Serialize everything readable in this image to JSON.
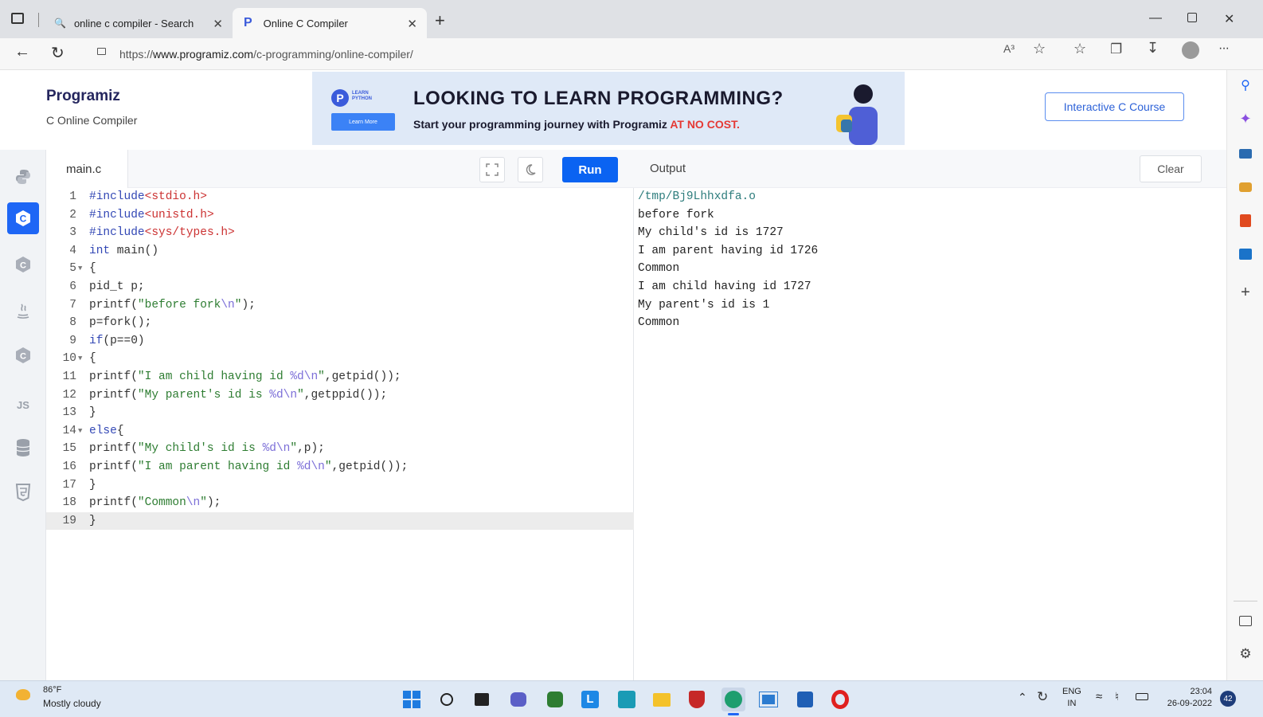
{
  "browser": {
    "tabs": [
      {
        "title": "online c compiler - Search",
        "active": false
      },
      {
        "title": "Online C Compiler",
        "active": true
      }
    ],
    "new_tab_label": "+",
    "url_scheme": "https://",
    "url_host": "www.programiz.com",
    "url_path": "/c-programming/online-compiler/",
    "read_aloud_label": "A³",
    "more_label": "···"
  },
  "site": {
    "logo": "Programiz",
    "subtitle": "C Online Compiler",
    "banner": {
      "headline": "LOOKING TO LEARN PROGRAMMING?",
      "tagline": "Start your programming journey with Programiz ",
      "tagline_highlight": "AT NO COST.",
      "badge_line1": "LEARN",
      "badge_line2": "PYTHON",
      "button": "Learn More"
    },
    "course_button": "Interactive C Course"
  },
  "languages": [
    {
      "icon": "python-icon",
      "label": ""
    },
    {
      "icon": "c-icon",
      "label": "C",
      "active": true
    },
    {
      "icon": "cpp-icon",
      "label": ""
    },
    {
      "icon": "java-icon",
      "label": ""
    },
    {
      "icon": "csharp-icon",
      "label": ""
    },
    {
      "icon": "javascript-icon",
      "label": "JS"
    },
    {
      "icon": "database-icon",
      "label": ""
    },
    {
      "icon": "html5-icon",
      "label": ""
    }
  ],
  "editor": {
    "filename": "main.c",
    "run_label": "Run",
    "lines": [
      {
        "n": "1",
        "text": "#include<stdio.h>"
      },
      {
        "n": "2",
        "text": "#include<unistd.h>"
      },
      {
        "n": "3",
        "text": "#include<sys/types.h>"
      },
      {
        "n": "4",
        "text": "int main()"
      },
      {
        "n": "5",
        "text": "{"
      },
      {
        "n": "6",
        "text": "pid_t p;"
      },
      {
        "n": "7",
        "text": "printf(\"before fork\\n\");"
      },
      {
        "n": "8",
        "text": "p=fork();"
      },
      {
        "n": "9",
        "text": "if(p==0)"
      },
      {
        "n": "10",
        "text": "{"
      },
      {
        "n": "11",
        "text": "printf(\"I am child having id %d\\n\",getpid());"
      },
      {
        "n": "12",
        "text": "printf(\"My parent's id is %d\\n\",getppid());"
      },
      {
        "n": "13",
        "text": "}"
      },
      {
        "n": "14",
        "text": "else{"
      },
      {
        "n": "15",
        "text": "printf(\"My child's id is %d\\n\",p);"
      },
      {
        "n": "16",
        "text": "printf(\"I am parent having id %d\\n\",getpid());"
      },
      {
        "n": "17",
        "text": "}"
      },
      {
        "n": "18",
        "text": "printf(\"Common\\n\");"
      },
      {
        "n": "19",
        "text": "}"
      }
    ]
  },
  "output": {
    "label": "Output",
    "clear_label": "Clear",
    "lines": [
      "/tmp/Bj9Lhhxdfa.o",
      "before fork",
      "My child's id is 1727",
      "I am parent having id 1726",
      "Common",
      "I am child having id 1727",
      "My parent's id is 1",
      "Common"
    ]
  },
  "taskbar": {
    "temperature": "86°F",
    "weather": "Mostly cloudy",
    "lang_line1": "ENG",
    "lang_line2": "IN",
    "time": "23:04",
    "date": "26-09-2022",
    "notifications": "42"
  },
  "colors": {
    "accent": "#0a63f2",
    "keyword": "#3348b5",
    "include": "#cc3333",
    "string": "#2e7d32"
  }
}
